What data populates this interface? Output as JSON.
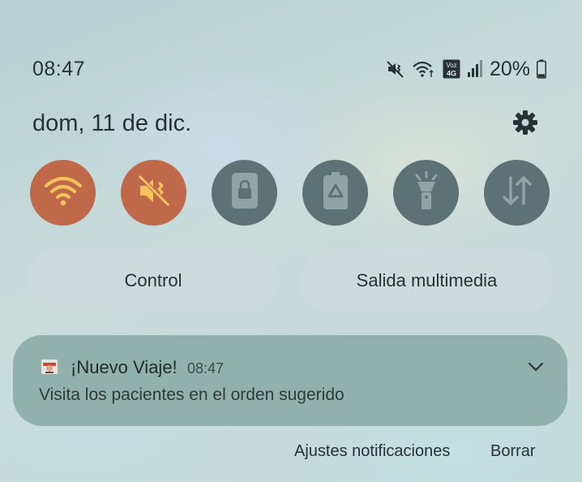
{
  "status_bar": {
    "time": "08:47",
    "battery_percent": "20%",
    "battery_level": 0.2,
    "network_label_top": "Voz",
    "network_label_bottom": "4G",
    "icons": [
      "mute-vibrate-icon",
      "wifi-icon",
      "volte-icon",
      "signal-icon",
      "battery-icon"
    ]
  },
  "header": {
    "date": "dom, 11 de dic.",
    "settings_icon": "gear-icon"
  },
  "quick_tiles": [
    {
      "name": "wifi",
      "icon": "wifi-icon",
      "state": "on"
    },
    {
      "name": "sound",
      "icon": "mute-vibrate-icon",
      "state": "on"
    },
    {
      "name": "screen-lock",
      "icon": "lock-icon",
      "state": "off"
    },
    {
      "name": "power-saving",
      "icon": "battery-recycle-icon",
      "state": "off"
    },
    {
      "name": "flashlight",
      "icon": "flashlight-icon",
      "state": "off"
    },
    {
      "name": "mobile-data",
      "icon": "data-arrows-icon",
      "state": "off"
    }
  ],
  "buttons": {
    "control": "Control",
    "media_output": "Salida multimedia"
  },
  "notification": {
    "title": "¡Nuevo Viaje!",
    "time": "08:47",
    "body": "Visita los pacientes en el orden sugerido"
  },
  "actions": {
    "settings": "Ajustes notificaciones",
    "clear": "Borrar"
  },
  "colors": {
    "tile_on": "#c0694a",
    "tile_off": "#5d7274",
    "notification_bg": "#92b1ad",
    "icon_on": "#f3c45a"
  }
}
